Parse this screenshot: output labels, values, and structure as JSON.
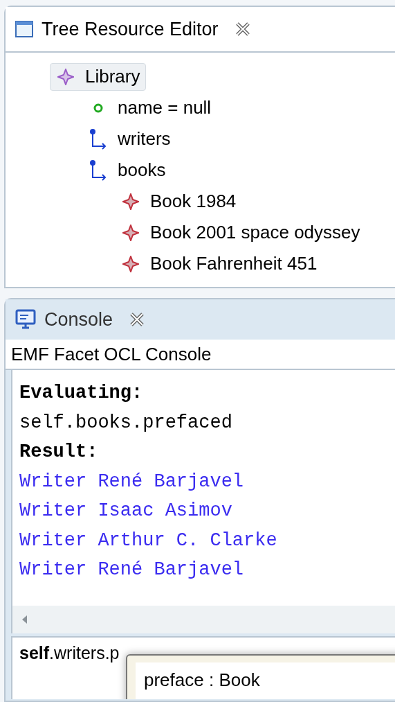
{
  "editor": {
    "tab": {
      "title": "Tree Resource Editor",
      "selected": true
    },
    "tree": [
      {
        "label": "Library",
        "kind": "class",
        "selected": true,
        "children": [
          {
            "label": "name = null",
            "kind": "attribute",
            "selected": false
          },
          {
            "label": "writers",
            "kind": "reference",
            "selected": false
          },
          {
            "label": "books",
            "kind": "reference",
            "selected": false,
            "children": [
              {
                "label": "Book 1984",
                "kind": "object",
                "selected": false
              },
              {
                "label": "Book 2001 space odyssey",
                "kind": "object",
                "selected": false
              },
              {
                "label": "Book Fahrenheit 451",
                "kind": "object",
                "selected": false
              }
            ]
          }
        ]
      }
    ]
  },
  "console": {
    "tab": {
      "title": "Console",
      "selected": false
    },
    "name": "EMF Facet OCL Console",
    "output": [
      {
        "text": "Evaluating:",
        "kind": "heading"
      },
      {
        "text": "self.books.prefaced",
        "kind": "query"
      },
      {
        "text": "Result:",
        "kind": "heading"
      },
      {
        "text": "Writer René Barjavel",
        "kind": "result"
      },
      {
        "text": "Writer Isaac Asimov",
        "kind": "result"
      },
      {
        "text": "Writer Arthur C. Clarke",
        "kind": "result"
      },
      {
        "text": "Writer René Barjavel",
        "kind": "result"
      }
    ],
    "input": "**self**.writers.p",
    "proposals": [
      {
        "label": "preface : Book",
        "selected": false
      }
    ]
  }
}
